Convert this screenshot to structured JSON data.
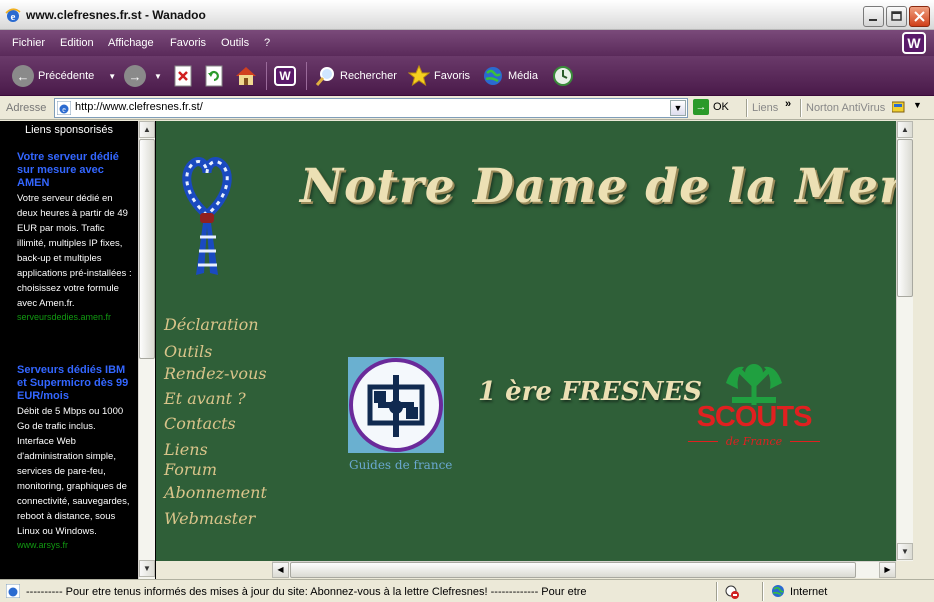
{
  "window": {
    "title": "www.clefresnes.fr.st - Wanadoo"
  },
  "menu": {
    "items": [
      "Fichier",
      "Edition",
      "Affichage",
      "Favoris",
      "Outils",
      "?"
    ]
  },
  "toolbar": {
    "back_label": "Précédente",
    "search_label": "Rechercher",
    "favorites_label": "Favoris",
    "media_label": "Média"
  },
  "address": {
    "label": "Adresse",
    "url": "http://www.clefresnes.fr.st/",
    "go_label": "OK",
    "links_label": "Liens",
    "norton_label": "Norton AntiVirus"
  },
  "sidebar": {
    "heading": "Liens sponsorisés",
    "ads": [
      {
        "title": "Votre serveur dédié sur mesure avec AMEN",
        "body": "Votre serveur dédié en deux heures à partir de 49 EUR par mois. Trafic illimité, multiples IP fixes, back-up et multiples applications pré-installées : choisissez votre formule avec Amen.fr.",
        "url": "serveursdedies.amen.fr"
      },
      {
        "title": "Serveurs dédiés IBM et Supermicro dès 99 EUR/mois",
        "body": "Débit de 5 Mbps ou 1000 Go de trafic inclus. Interface Web d'administration simple, services de pare-feu, monitoring, graphiques de connectivité, sauvegardes, reboot à distance, sous Linux ou Windows.",
        "url": "www.arsys.fr"
      }
    ]
  },
  "page": {
    "site_title": "Notre Dame de la Merci",
    "nav": [
      "Déclaration",
      "Outils",
      "Rendez-vous",
      "Et avant ?",
      "Contacts",
      "Liens",
      "Forum",
      "Abonnement",
      "Webmaster"
    ],
    "guides_caption": "Guides de france",
    "fresnes_text": "1 ère FRESNES",
    "scouts_name": "SCOUTS",
    "scouts_sub": "de France"
  },
  "status": {
    "text": "----------    Pour etre tenus informés des mises à jour du site: Abonnez-vous à la lettre Clefresnes! -------------     Pour etre",
    "zone": "Internet"
  },
  "colors": {
    "menu_bar": "#5a2a5a",
    "page_background": "#2f5f38",
    "nav_link": "#d9c48a",
    "ad_title": "#3366ff",
    "ad_url": "#119911",
    "scouts_red": "#e02020",
    "guides_caption": "#6aa8d0"
  }
}
